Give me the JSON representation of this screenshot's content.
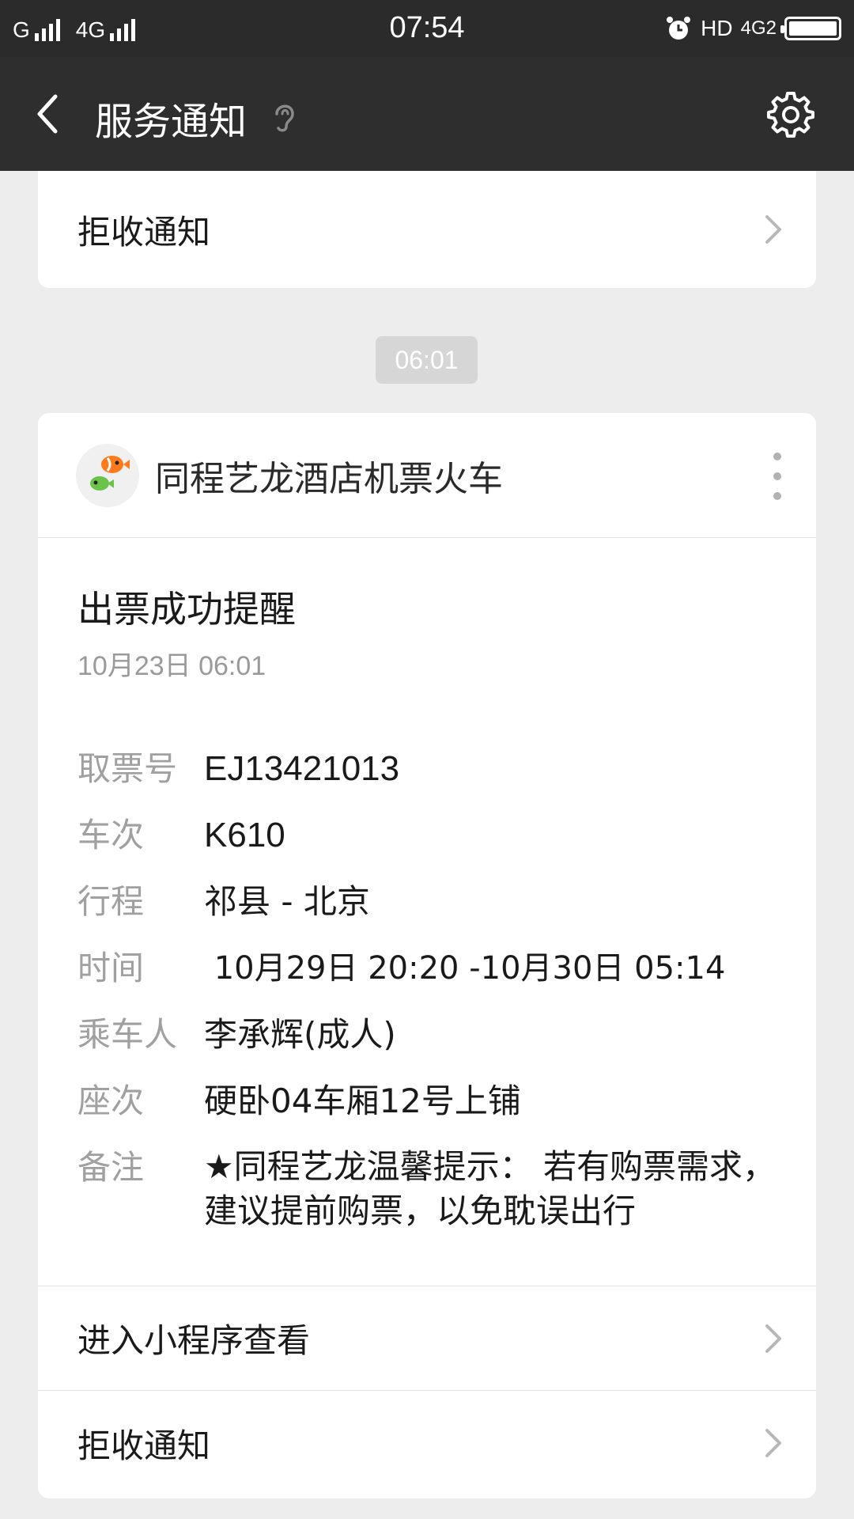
{
  "status_bar": {
    "carrier_1": "G",
    "carrier_2": "4G",
    "time": "07:54",
    "hd_label": "HD",
    "network_label": "4G2"
  },
  "app_bar": {
    "title": "服务通知",
    "back_icon": "chevron-left-icon",
    "ear_icon": "ear-icon",
    "settings_icon": "gear-icon"
  },
  "top_card": {
    "reject_label": "拒收通知"
  },
  "timestamp": "06:01",
  "message": {
    "sender": "同程艺龙酒店机票火车",
    "title": "出票成功提醒",
    "date": "10月23日  06:01",
    "fields": [
      {
        "label": "取票号",
        "value": "EJ13421013"
      },
      {
        "label": "车次",
        "value": "K610"
      },
      {
        "label": "行程",
        "value": "祁县 - 北京"
      },
      {
        "label": "时间",
        "value": " 10月29日 20:20 -10月30日 05:14"
      },
      {
        "label": "乘车人",
        "value": "李承辉(成人)"
      },
      {
        "label": "座次",
        "value": "硬卧04车厢12号上铺"
      },
      {
        "label": "备注",
        "value": "★同程艺龙温馨提示： 若有购票需求，建议提前购票，以免耽误出行"
      }
    ],
    "open_miniprogram": "进入小程序查看",
    "reject_label": "拒收通知"
  },
  "colors": {
    "app_bar": "#2e2e2e",
    "background": "#ededed",
    "card": "#ffffff"
  }
}
